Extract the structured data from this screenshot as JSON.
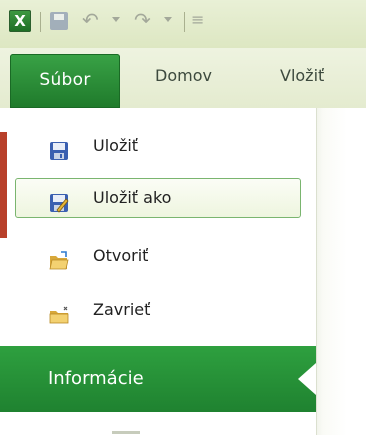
{
  "quick_access": {
    "app_icon": "excel-icon",
    "app_icon_letter": "X",
    "save_icon": "save-icon",
    "undo_icon": "undo-icon",
    "redo_icon": "redo-icon",
    "customize_icon": "customize-dropdown-icon"
  },
  "ribbon": {
    "file_tab": "Súbor",
    "tabs": [
      "Domov",
      "Vložiť"
    ]
  },
  "backstage": {
    "items": [
      {
        "label": "Uložiť",
        "icon": "save-icon"
      },
      {
        "label": "Uložiť ako",
        "icon": "save-as-icon",
        "selected": true
      },
      {
        "label": "Otvoriť",
        "icon": "open-folder-icon"
      },
      {
        "label": "Zavrieť",
        "icon": "close-folder-icon"
      }
    ],
    "active_section": "Informácie"
  },
  "colors": {
    "accent_green": "#1f8230",
    "file_tab_green": "#2b8c38",
    "selection_border": "#7ab56f",
    "background": "#dfe8c4"
  }
}
